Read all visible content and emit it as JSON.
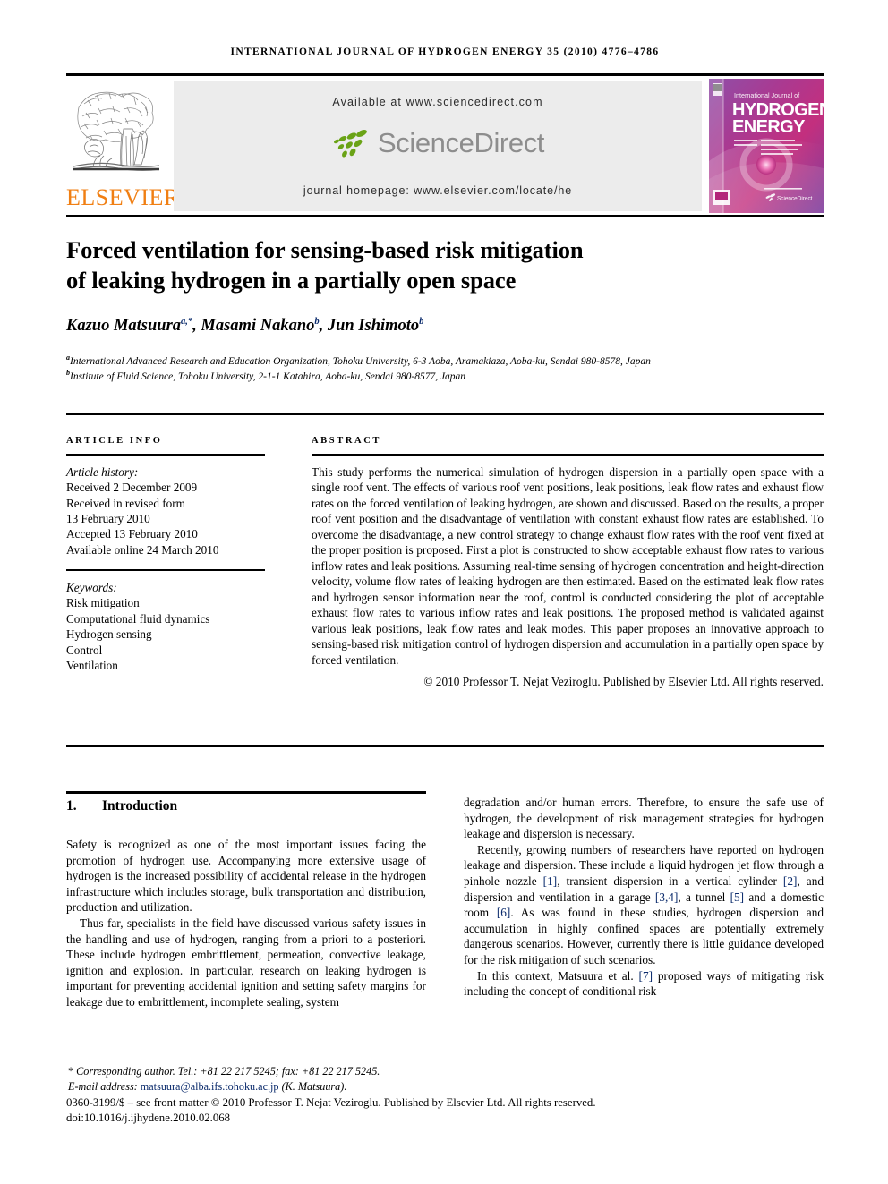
{
  "running_head": "INTERNATIONAL JOURNAL OF HYDROGEN ENERGY 35 (2010) 4776–4786",
  "masthead": {
    "publisher_name": "ELSEVIER",
    "publisher_logo_name": "elsevier-tree-logo",
    "available_at": "Available at www.sciencedirect.com",
    "sciencedirect_wordmark": "ScienceDirect",
    "journal_homepage": "journal homepage: www.elsevier.com/locate/he",
    "cover": {
      "line1": "International Journal of",
      "line2": "HYDROGEN",
      "line3": "ENERGY",
      "badge": "ScienceDirect"
    },
    "colors": {
      "elsevier_orange": "#f07f13",
      "sciencedirect_green": "#6aa316",
      "sciencedirect_grey": "#8d8d8d",
      "panel_grey": "#ececec",
      "cover_magenta": "#b8307f",
      "link_navy": "#0a2a6b"
    }
  },
  "article": {
    "title_line1": "Forced ventilation for sensing-based risk mitigation",
    "title_line2": "of leaking hydrogen in a partially open space",
    "authors": [
      {
        "name": "Kazuo Matsuura",
        "sup": "a,*"
      },
      {
        "name": "Masami Nakano",
        "sup": "b"
      },
      {
        "name": "Jun Ishimoto",
        "sup": "b"
      }
    ],
    "affiliations": [
      {
        "marker": "a",
        "text": "International Advanced Research and Education Organization, Tohoku University, 6-3 Aoba, Aramakiaza, Aoba-ku, Sendai 980-8578, Japan"
      },
      {
        "marker": "b",
        "text": "Institute of Fluid Science, Tohoku University, 2-1-1 Katahira, Aoba-ku, Sendai 980-8577, Japan"
      }
    ]
  },
  "article_info": {
    "heading": "ARTICLE INFO",
    "history_label": "Article history:",
    "history": [
      "Received 2 December 2009",
      "Received in revised form",
      "13 February 2010",
      "Accepted 13 February 2010",
      "Available online 24 March 2010"
    ],
    "keywords_label": "Keywords:",
    "keywords": [
      "Risk mitigation",
      "Computational fluid dynamics",
      "Hydrogen sensing",
      "Control",
      "Ventilation"
    ]
  },
  "abstract": {
    "heading": "ABSTRACT",
    "text": "This study performs the numerical simulation of hydrogen dispersion in a partially open space with a single roof vent. The effects of various roof vent positions, leak positions, leak flow rates and exhaust flow rates on the forced ventilation of leaking hydrogen, are shown and discussed. Based on the results, a proper roof vent position and the disadvantage of ventilation with constant exhaust flow rates are established. To overcome the disadvantage, a new control strategy to change exhaust flow rates with the roof vent fixed at the proper position is proposed. First a plot is constructed to show acceptable exhaust flow rates to various inflow rates and leak positions. Assuming real-time sensing of hydrogen concentration and height-direction velocity, volume flow rates of leaking hydrogen are then estimated. Based on the estimated leak flow rates and hydrogen sensor information near the roof, control is conducted considering the plot of acceptable exhaust flow rates to various inflow rates and leak positions. The proposed method is validated against various leak positions, leak flow rates and leak modes. This paper proposes an innovative approach to sensing-based risk mitigation control of hydrogen dispersion and accumulation in a partially open space by forced ventilation.",
    "copyright": "© 2010 Professor T. Nejat Veziroglu. Published by Elsevier Ltd. All rights reserved."
  },
  "section": {
    "number": "1.",
    "title": "Introduction"
  },
  "body": {
    "left": [
      "Safety is recognized as one of the most important issues facing the promotion of hydrogen use. Accompanying more extensive usage of hydrogen is the increased possibility of accidental release in the hydrogen infrastructure which includes storage, bulk transportation and distribution, production and utilization.",
      "Thus far, specialists in the field have discussed various safety issues in the handling and use of hydrogen, ranging from a priori to a posteriori. These include hydrogen embrittlement, permeation, convective leakage, ignition and explosion. In particular, research on leaking hydrogen is important for preventing accidental ignition and setting safety margins for leakage due to embrittlement, incomplete sealing, system"
    ],
    "right_para1": "degradation and/or human errors. Therefore, to ensure the safe use of hydrogen, the development of risk management strategies for hydrogen leakage and dispersion is necessary.",
    "right_para2_a": "Recently, growing numbers of researchers have reported on hydrogen leakage and dispersion. These include a liquid hydrogen jet flow through a pinhole nozzle ",
    "right_ref1": "[1]",
    "right_para2_b": ", transient dispersion in a vertical cylinder ",
    "right_ref2": "[2]",
    "right_para2_c": ", and dispersion and ventilation in a garage ",
    "right_ref34": "[3,4]",
    "right_para2_d": ", a tunnel ",
    "right_ref5": "[5]",
    "right_para2_e": " and a domestic room ",
    "right_ref6": "[6]",
    "right_para2_f": ". As was found in these studies, hydrogen dispersion and accumulation in highly confined spaces are potentially extremely dangerous scenarios. However, currently there is little guidance developed for the risk mitigation of such scenarios.",
    "right_para3_a": "In this context, Matsuura et al. ",
    "right_ref7": "[7]",
    "right_para3_b": " proposed ways of mitigating risk including the concept of conditional risk"
  },
  "footnote": {
    "corresponding": "Corresponding author. Tel.: +81 22 217 5245; fax: +81 22 217 5245.",
    "email_label": "E-mail address: ",
    "email": "matsuura@alba.ifs.tohoku.ac.jp",
    "email_suffix": " (K. Matsuura).",
    "imprint": "0360-3199/$ – see front matter © 2010 Professor T. Nejat Veziroglu. Published by Elsevier Ltd. All rights reserved.",
    "doi": "doi:10.1016/j.ijhydene.2010.02.068"
  }
}
